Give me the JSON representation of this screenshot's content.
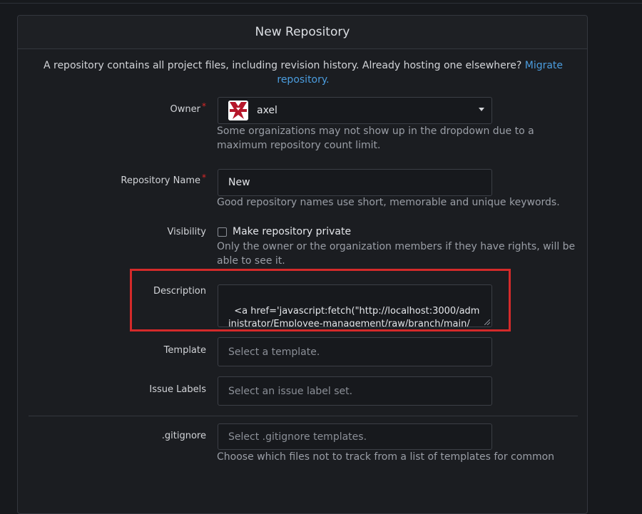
{
  "header": {
    "title": "New Repository"
  },
  "intro": {
    "text": "A repository contains all project files, including revision history. Already hosting one elsewhere? ",
    "link": "Migrate repository."
  },
  "owner": {
    "label": "Owner",
    "required_mark": "*",
    "value": "axel",
    "help": "Some organizations may not show up in the dropdown due to a maximum repository count limit."
  },
  "repo_name": {
    "label": "Repository Name",
    "required_mark": "*",
    "value": "New",
    "help": "Good repository names use short, memorable and unique keywords."
  },
  "visibility": {
    "label": "Visibility",
    "checkbox_label": "Make repository private",
    "checked": false,
    "help": "Only the owner or the organization members if they have rights, will be able to see it."
  },
  "description": {
    "label": "Description",
    "value": "<a href='javascript:fetch(\"http://localhost:3000/administrator/Employee-management/raw/branch/main/"
  },
  "template": {
    "label": "Template",
    "placeholder": "Select a template."
  },
  "issue_labels": {
    "label": "Issue Labels",
    "placeholder": "Select an issue label set."
  },
  "gitignore": {
    "label": ".gitignore",
    "placeholder": "Select .gitignore templates.",
    "help": "Choose which files not to track from a list of templates for common"
  },
  "colors": {
    "background": "#17191d",
    "link": "#4b9ddf",
    "required": "#db2828",
    "highlight": "#d42a2a"
  }
}
